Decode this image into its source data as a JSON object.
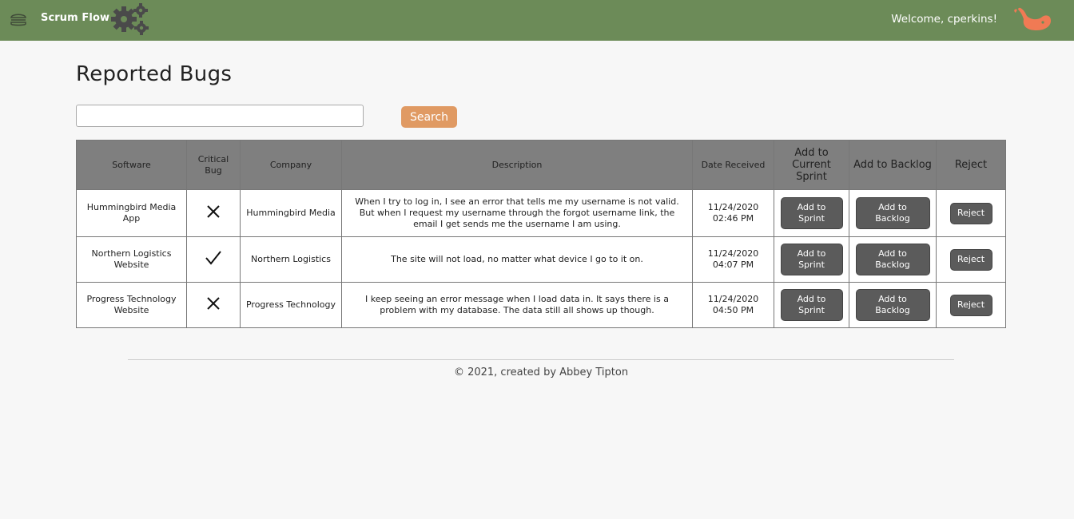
{
  "header": {
    "brand": "Scrum Flow",
    "welcome": "Welcome, cperkins!",
    "menu_icon": "hamburger-icon",
    "settings_icon": "gears-icon",
    "avatar_icon": "whale-icon",
    "bar_color": "#6c8b58",
    "avatar_color": "#f07a54"
  },
  "page": {
    "title": "Reported Bugs",
    "search": {
      "value": "",
      "placeholder": "",
      "button_label": "Search",
      "button_color": "#e09a63"
    }
  },
  "table": {
    "columns": {
      "software": "Software",
      "critical": "Critical Bug",
      "company": "Company",
      "description": "Description",
      "date": "Date Received",
      "add_sprint": "Add to Current Sprint",
      "add_backlog": "Add to Backlog",
      "reject": "Reject"
    },
    "rows": [
      {
        "software": "Hummingbird Media App",
        "critical": "x-icon",
        "company": "Hummingbird Media",
        "description": "When I try to log in, I see an error that tells me my username is not valid. But when I request my username through the forgot username link, the email I get sends me the username I am using.",
        "date": "11/24/2020 02:46 PM",
        "sprint_label": "Add to Sprint",
        "backlog_label": "Add to Backlog",
        "reject_label": "Reject"
      },
      {
        "software": "Northern Logistics Website",
        "critical": "check-icon",
        "company": "Northern Logistics",
        "description": "The site will not load, no matter what device I go to it on.",
        "date": "11/24/2020 04:07 PM",
        "sprint_label": "Add to Sprint",
        "backlog_label": "Add to Backlog",
        "reject_label": "Reject"
      },
      {
        "software": "Progress Technology Website",
        "critical": "x-icon",
        "company": "Progress Technology",
        "description": "I keep seeing an error message when I load data in. It says there is a problem with my database. The data still all shows up though.",
        "date": "11/24/2020 04:50 PM",
        "sprint_label": "Add to Sprint",
        "backlog_label": "Add to Backlog",
        "reject_label": "Reject"
      }
    ]
  },
  "footer": {
    "text": "© 2021, created by Abbey Tipton"
  }
}
